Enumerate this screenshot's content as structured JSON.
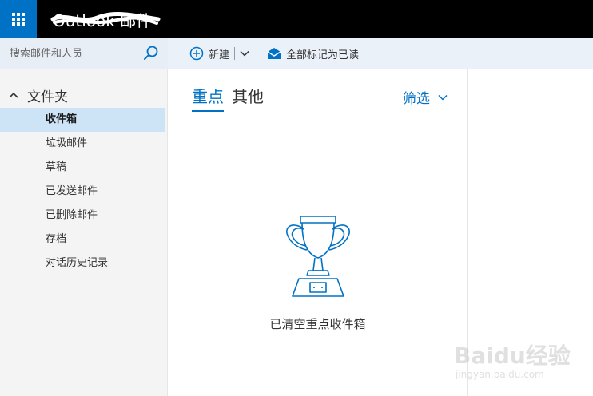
{
  "header": {
    "app_title": "Outlook 邮件"
  },
  "sidebar": {
    "search_placeholder": "搜索邮件和人员",
    "folders_label": "文件夹",
    "items": [
      {
        "label": "收件箱",
        "selected": true
      },
      {
        "label": "垃圾邮件",
        "selected": false
      },
      {
        "label": "草稿",
        "selected": false
      },
      {
        "label": "已发送邮件",
        "selected": false
      },
      {
        "label": "已删除邮件",
        "selected": false
      },
      {
        "label": "存档",
        "selected": false
      },
      {
        "label": "对话历史记录",
        "selected": false
      }
    ]
  },
  "toolbar": {
    "new_label": "新建",
    "mark_all_read_label": "全部标记为已读"
  },
  "list": {
    "tabs": [
      {
        "label": "重点",
        "active": true
      },
      {
        "label": "其他",
        "active": false
      }
    ],
    "filter_label": "筛选",
    "empty_message": "已清空重点收件箱"
  },
  "watermark": {
    "brand": "Baidu经验",
    "url": "jingyan.baidu.com"
  },
  "colors": {
    "accent": "#0072c6",
    "topbar": "#000000",
    "selected_bg": "#cde3f6",
    "toolbar_bg": "#eaf1f8",
    "sidebar_bg": "#f4f4f4"
  }
}
